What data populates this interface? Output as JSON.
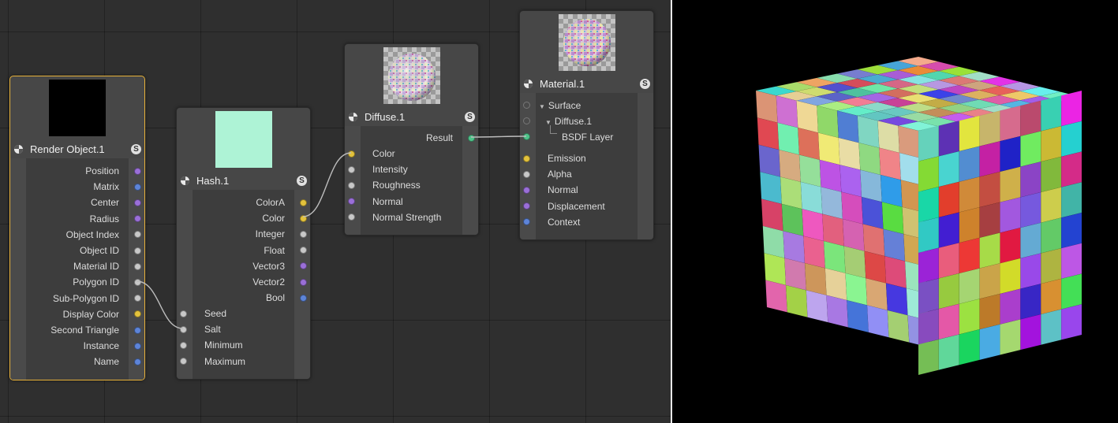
{
  "colors": {
    "port_purple": "#9a6fd8",
    "port_blue": "#5d84d8",
    "port_gray": "#c8c8c8",
    "port_yellow": "#e3c23c",
    "port_green": "#4fc38a",
    "selected_outline": "#e8b23a",
    "hash_preview": "#aef3d6",
    "render_preview": "#000000"
  },
  "nodes": {
    "render_object": {
      "title": "Render Object.1",
      "badge": "S",
      "outputs": [
        {
          "label": "Position",
          "port": "purple"
        },
        {
          "label": "Matrix",
          "port": "blue"
        },
        {
          "label": "Center",
          "port": "purple"
        },
        {
          "label": "Radius",
          "port": "purple"
        },
        {
          "label": "Object Index",
          "port": "gray"
        },
        {
          "label": "Object ID",
          "port": "gray"
        },
        {
          "label": "Material ID",
          "port": "gray"
        },
        {
          "label": "Polygon ID",
          "port": "gray"
        },
        {
          "label": "Sub-Polygon ID",
          "port": "gray"
        },
        {
          "label": "Display Color",
          "port": "yellow"
        },
        {
          "label": "Second Triangle",
          "port": "blue"
        },
        {
          "label": "Instance",
          "port": "blue"
        },
        {
          "label": "Name",
          "port": "blue"
        }
      ]
    },
    "hash": {
      "title": "Hash.1",
      "badge": "S",
      "outputs": [
        {
          "label": "ColorA",
          "port": "yellow"
        },
        {
          "label": "Color",
          "port": "yellow"
        },
        {
          "label": "Integer",
          "port": "gray"
        },
        {
          "label": "Float",
          "port": "gray"
        },
        {
          "label": "Vector3",
          "port": "purple"
        },
        {
          "label": "Vector2",
          "port": "purple"
        },
        {
          "label": "Bool",
          "port": "blue"
        }
      ],
      "inputs": [
        {
          "label": "Seed",
          "port": "gray"
        },
        {
          "label": "Salt",
          "port": "gray"
        },
        {
          "label": "Minimum",
          "port": "gray"
        },
        {
          "label": "Maximum",
          "port": "gray"
        }
      ]
    },
    "diffuse": {
      "title": "Diffuse.1",
      "badge": "S",
      "outputs": [
        {
          "label": "Result",
          "port": "green"
        }
      ],
      "inputs": [
        {
          "label": "Color",
          "port": "yellow"
        },
        {
          "label": "Intensity",
          "port": "gray"
        },
        {
          "label": "Roughness",
          "port": "gray"
        },
        {
          "label": "Normal",
          "port": "purple"
        },
        {
          "label": "Normal Strength",
          "port": "gray"
        }
      ]
    },
    "material": {
      "title": "Material.1",
      "badge": "S",
      "surface": "Surface",
      "diffuse_child": "Diffuse.1",
      "bsdf_layer": "BSDF Layer",
      "inputs": [
        {
          "label": "Emission",
          "port": "yellow"
        },
        {
          "label": "Alpha",
          "port": "gray"
        },
        {
          "label": "Normal",
          "port": "purple"
        },
        {
          "label": "Displacement",
          "port": "purple"
        },
        {
          "label": "Context",
          "port": "blue"
        }
      ]
    }
  }
}
